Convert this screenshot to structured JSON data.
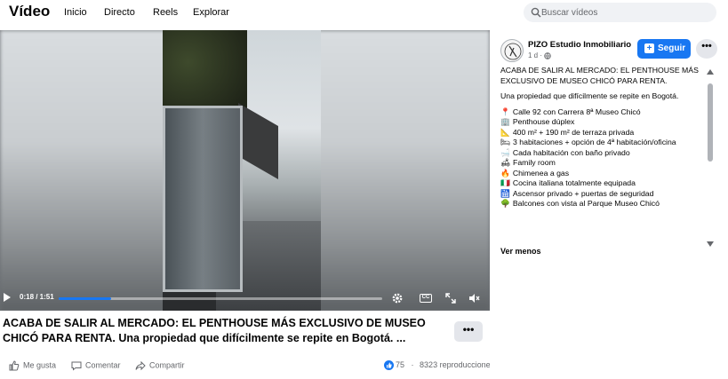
{
  "nav": {
    "brand": "Vídeo",
    "items": [
      "Inicio",
      "Directo",
      "Reels",
      "Explorar"
    ],
    "search_placeholder": "Buscar vídeos"
  },
  "player": {
    "time": "0:18 / 1:51",
    "progress_fraction": 0.162
  },
  "video_title": "ACABA DE SALIR AL MERCADO: EL PENTHOUSE MÁS EXCLUSIVO DE MUSEO CHICÓ PARA RENTA. Una propiedad que difícilmente se repite en Bogotá. ...",
  "actions": {
    "like": "Me gusta",
    "comment": "Comentar",
    "share": "Compartir"
  },
  "stats": {
    "reactions": "75",
    "views": "8323 reproducciones"
  },
  "sidebar": {
    "page_name": "PIZO Estudio Inmobiliario",
    "post_age": "1 d",
    "follow_label": "Seguir",
    "headline": "ACABA DE SALIR AL MERCADO: EL PENTHOUSE MÁS EXCLUSIVO DE MUSEO CHICÓ PARA RENTA.",
    "intro": "Una propiedad que difícilmente se repite en Bogotá.",
    "bullets": [
      {
        "icon": "📍",
        "text": "Calle 92 con Carrera 8ª Museo Chicó"
      },
      {
        "icon": "🏢",
        "text": "Penthouse dúplex"
      },
      {
        "icon": "📐",
        "text": "400 m² + 190 m² de terraza privada"
      },
      {
        "icon": "🛏",
        "text": "3 habitaciones + opción de 4ª habitación/oficina"
      },
      {
        "icon": "🛁",
        "text": "Cada habitación con baño privado"
      },
      {
        "icon": "🛋",
        "text": "Family room"
      },
      {
        "icon": "🔥",
        "text": "Chimenea a gas"
      },
      {
        "icon": "🇮🇹",
        "text": "Cocina italiana totalmente equipada"
      },
      {
        "icon": "🛗",
        "text": "Ascensor privado + puertas de seguridad"
      },
      {
        "icon": "🌳",
        "text": "Balcones con vista al Parque Museo Chicó"
      }
    ],
    "see_less": "Ver menos"
  }
}
